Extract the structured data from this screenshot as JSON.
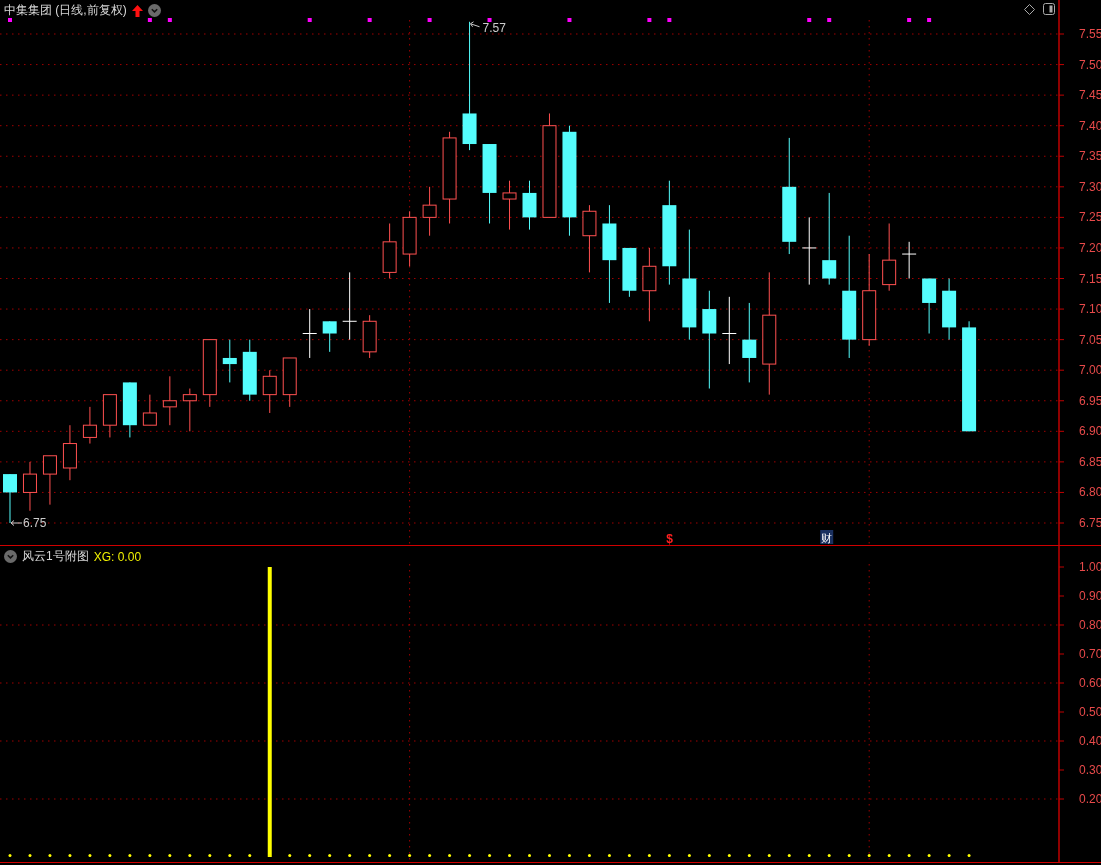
{
  "main_pane": {
    "title": "中集集团 (日线,前复权)",
    "high_label": "7.57",
    "low_label": "6.75",
    "event_mark": "$",
    "finance_mark": "财",
    "chart_data": {
      "type": "candlestick",
      "ylim": [
        6.75,
        7.55
      ],
      "grid": true,
      "yticks": [
        {
          "value": 7.55,
          "label": "7.55"
        },
        {
          "value": 7.5,
          "label": "7.50"
        },
        {
          "value": 7.45,
          "label": "7.45"
        },
        {
          "value": 7.4,
          "label": "7.40"
        },
        {
          "value": 7.35,
          "label": "7.35"
        },
        {
          "value": 7.3,
          "label": "7.30"
        },
        {
          "value": 7.25,
          "label": "7.25"
        },
        {
          "value": 7.2,
          "label": "7.20"
        },
        {
          "value": 7.15,
          "label": "7.15"
        },
        {
          "value": 7.1,
          "label": "7.10"
        },
        {
          "value": 7.05,
          "label": "7.05"
        },
        {
          "value": 7.0,
          "label": "7.00"
        },
        {
          "value": 6.95,
          "label": "6.95"
        },
        {
          "value": 6.9,
          "label": "6.90"
        },
        {
          "value": 6.85,
          "label": "6.85"
        },
        {
          "value": 6.8,
          "label": "6.80"
        },
        {
          "value": 6.75,
          "label": "6.75"
        }
      ],
      "categories": [
        null,
        null,
        null,
        null,
        null,
        null,
        null,
        null,
        null,
        null,
        null,
        null,
        null,
        null,
        null,
        null,
        null,
        null,
        null,
        null,
        null,
        null,
        null,
        null,
        null,
        null,
        null,
        null,
        null,
        null,
        null,
        null,
        null,
        null,
        null,
        null,
        null,
        null,
        null,
        null,
        null,
        null,
        null,
        null,
        null,
        null,
        null,
        null,
        null,
        null,
        null,
        null,
        null
      ],
      "ohlc": [
        [
          6.83,
          6.83,
          6.75,
          6.8
        ],
        [
          6.8,
          6.85,
          6.77,
          6.83
        ],
        [
          6.83,
          6.86,
          6.78,
          6.86
        ],
        [
          6.84,
          6.91,
          6.82,
          6.88
        ],
        [
          6.89,
          6.94,
          6.88,
          6.91
        ],
        [
          6.91,
          6.96,
          6.89,
          6.96
        ],
        [
          6.98,
          6.98,
          6.89,
          6.91
        ],
        [
          6.91,
          6.96,
          6.91,
          6.93
        ],
        [
          6.94,
          6.99,
          6.91,
          6.95
        ],
        [
          6.95,
          6.97,
          6.9,
          6.96
        ],
        [
          6.96,
          7.05,
          6.94,
          7.05
        ],
        [
          7.02,
          7.05,
          6.98,
          7.01
        ],
        [
          7.03,
          7.05,
          6.95,
          6.96
        ],
        [
          6.96,
          7.0,
          6.93,
          6.99
        ],
        [
          6.96,
          7.02,
          6.94,
          7.02
        ],
        [
          7.06,
          7.1,
          7.02,
          7.06
        ],
        [
          7.08,
          7.08,
          7.03,
          7.06
        ],
        [
          7.08,
          7.16,
          7.05,
          7.08
        ],
        [
          7.03,
          7.09,
          7.02,
          7.08
        ],
        [
          7.16,
          7.24,
          7.15,
          7.21
        ],
        [
          7.19,
          7.26,
          7.17,
          7.25
        ],
        [
          7.25,
          7.3,
          7.22,
          7.27
        ],
        [
          7.28,
          7.39,
          7.24,
          7.38
        ],
        [
          7.42,
          7.57,
          7.36,
          7.37
        ],
        [
          7.37,
          7.37,
          7.24,
          7.29
        ],
        [
          7.28,
          7.31,
          7.23,
          7.29
        ],
        [
          7.29,
          7.31,
          7.23,
          7.25
        ],
        [
          7.25,
          7.42,
          7.25,
          7.4
        ],
        [
          7.39,
          7.4,
          7.22,
          7.25
        ],
        [
          7.22,
          7.27,
          7.16,
          7.26
        ],
        [
          7.24,
          7.27,
          7.11,
          7.18
        ],
        [
          7.2,
          7.2,
          7.12,
          7.13
        ],
        [
          7.13,
          7.2,
          7.08,
          7.17
        ],
        [
          7.27,
          7.31,
          7.14,
          7.17
        ],
        [
          7.15,
          7.23,
          7.05,
          7.07
        ],
        [
          7.1,
          7.13,
          6.97,
          7.06
        ],
        [
          7.06,
          7.12,
          7.01,
          7.06
        ],
        [
          7.05,
          7.11,
          6.98,
          7.02
        ],
        [
          7.01,
          7.16,
          6.96,
          7.09
        ],
        [
          7.3,
          7.38,
          7.19,
          7.21
        ],
        [
          7.2,
          7.25,
          7.14,
          7.2
        ],
        [
          7.18,
          7.29,
          7.14,
          7.15
        ],
        [
          7.13,
          7.22,
          7.02,
          7.05
        ],
        [
          7.05,
          7.19,
          7.04,
          7.13
        ],
        [
          7.14,
          7.24,
          7.13,
          7.18
        ],
        [
          7.19,
          7.21,
          7.15,
          7.19
        ],
        [
          7.15,
          7.15,
          7.06,
          7.11
        ],
        [
          7.13,
          7.15,
          7.05,
          7.07
        ],
        [
          7.07,
          7.08,
          6.9,
          6.9
        ],
        null,
        null,
        null,
        null
      ]
    }
  },
  "indicator_pane": {
    "name": "风云1号附图",
    "readout": "XG: 0.00",
    "chart_data": {
      "type": "bar",
      "ylim": [
        0,
        1
      ],
      "grid": true,
      "yticks": [
        {
          "value": 1.0,
          "label": "1.00"
        },
        {
          "value": 0.9,
          "label": "0.90"
        },
        {
          "value": 0.8,
          "label": "0.80"
        },
        {
          "value": 0.7,
          "label": "0.70"
        },
        {
          "value": 0.6,
          "label": "0.60"
        },
        {
          "value": 0.5,
          "label": "0.50"
        },
        {
          "value": 0.4,
          "label": "0.40"
        },
        {
          "value": 0.3,
          "label": "0.30"
        },
        {
          "value": 0.2,
          "label": "0.20"
        }
      ],
      "series": [
        {
          "color": "#ffff00",
          "values": [
            0,
            0,
            0,
            0,
            0,
            0,
            0,
            0,
            0,
            0,
            0,
            0,
            0,
            1,
            0,
            0,
            0,
            0,
            0,
            0,
            0,
            0,
            0,
            0,
            0,
            0,
            0,
            0,
            0,
            0,
            0,
            0,
            0,
            0,
            0,
            0,
            0,
            0,
            0,
            0,
            0,
            0,
            0,
            0,
            0,
            0,
            0,
            0,
            0,
            null,
            null,
            null,
            null
          ]
        }
      ]
    }
  }
}
